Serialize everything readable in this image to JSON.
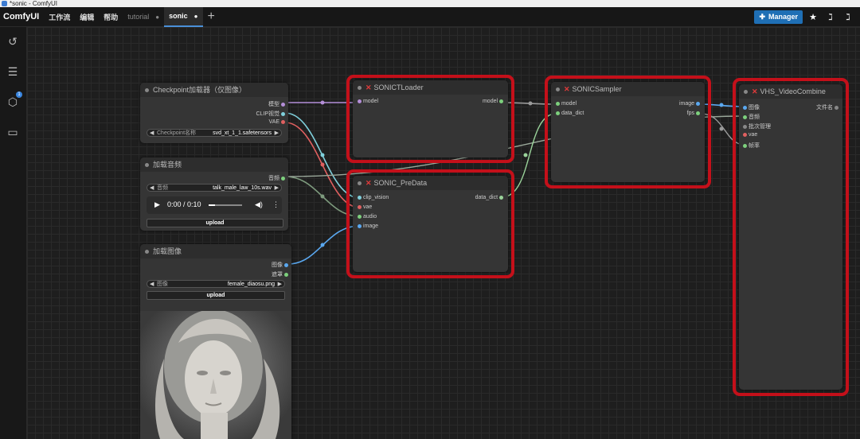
{
  "window_title": "*sonic - ComfyUI",
  "menubar": {
    "brand": "ComfyUI",
    "menus": [
      "工作流",
      "编辑",
      "帮助"
    ],
    "tabs": [
      {
        "label": "tutorial",
        "marker": "●"
      },
      {
        "label": "sonic",
        "marker": "●"
      }
    ],
    "add_tab": "+",
    "manager_label": "Manager"
  },
  "nodes": {
    "checkpoint": {
      "title": "Checkpoint加载器（仅图像）",
      "outputs": [
        "模型",
        "CLIP视觉",
        "VAE"
      ],
      "widget_label": "Checkpoint名称",
      "widget_value": "svd_xt_1_1.safetensors"
    },
    "audio": {
      "title": "加载音频",
      "output": "音频",
      "widget_label": "音频",
      "widget_value": "talk_male_law_10s.wav",
      "time": "0:00 / 0:10",
      "upload": "upload"
    },
    "image": {
      "title": "加载图像",
      "outputs": [
        "图像",
        "遮罩"
      ],
      "widget_label": "图像",
      "widget_value": "female_diaosu.png",
      "upload": "upload"
    },
    "loader": {
      "title": "SONICTLoader",
      "input": "model",
      "output": "model"
    },
    "predata": {
      "title": "SONIC_PreData",
      "inputs": [
        "clip_vision",
        "vae",
        "audio",
        "image"
      ],
      "output": "data_dict"
    },
    "sampler": {
      "title": "SONICSampler",
      "inputs": [
        "model",
        "data_dict"
      ],
      "outputs": [
        "image",
        "fps"
      ]
    },
    "combine": {
      "title": "VHS_VideoCombine",
      "inputs": [
        "图像",
        "音频",
        "批次管理",
        "vae",
        "帧率"
      ],
      "output": "文件名"
    }
  },
  "colors": {
    "model": "#b48ed8",
    "clip": "#7fd0dc",
    "vae": "#e06060",
    "audio": "#7dd07d",
    "image": "#5aa8f0",
    "data": "#9ad39a",
    "highlight": "#c4101a"
  }
}
